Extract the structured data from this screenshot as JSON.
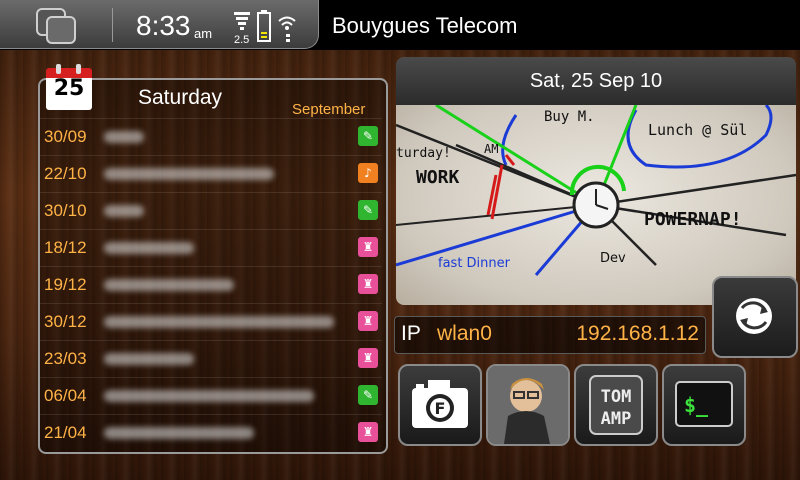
{
  "statusbar": {
    "time": "8:33",
    "ampm": "am",
    "network_type": "2.5",
    "carrier": "Bouygues Telecom"
  },
  "calendar": {
    "icon_day": "25",
    "day_name": "Saturday",
    "month": "September",
    "events": [
      {
        "date": "30/09",
        "title": "",
        "badge_color": "#2fb52f",
        "badge_icon": "tag-icon"
      },
      {
        "date": "22/10",
        "title": "",
        "badge_color": "#f08020",
        "badge_icon": "bell-icon"
      },
      {
        "date": "30/10",
        "title": "",
        "badge_color": "#2fb52f",
        "badge_icon": "tag-icon"
      },
      {
        "date": "18/12",
        "title": "",
        "badge_color": "#e8509a",
        "badge_icon": "cake-icon"
      },
      {
        "date": "19/12",
        "title": "",
        "badge_color": "#e8509a",
        "badge_icon": "cake-icon"
      },
      {
        "date": "30/12",
        "title": "",
        "badge_color": "#e8509a",
        "badge_icon": "cake-icon"
      },
      {
        "date": "23/03",
        "title": "",
        "badge_color": "#e8509a",
        "badge_icon": "cake-icon"
      },
      {
        "date": "06/04",
        "title": "",
        "badge_color": "#2fb52f",
        "badge_icon": "tag-icon"
      },
      {
        "date": "21/04",
        "title": "",
        "badge_color": "#e8509a",
        "badge_icon": "cake-icon"
      }
    ]
  },
  "widget": {
    "date_header": "Sat, 25 Sep 10",
    "whiteboard": {
      "text_buy": "Buy M.",
      "text_am": "AM",
      "text_lunch": "Lunch @ Sül",
      "text_saturday": "turday!",
      "text_work": "WORK",
      "text_powernap": "POWERNAP!",
      "text_fast_dinner": "fast Dinner",
      "text_dev": "Dev"
    }
  },
  "ip": {
    "label": "IP",
    "interface": "wlan0",
    "address": "192.168.1.12"
  },
  "apps": [
    {
      "name": "camera-app",
      "icon": "camera-icon"
    },
    {
      "name": "avatar-app",
      "icon": "avatar-icon"
    },
    {
      "name": "tomamp-app",
      "icon": "tomamp-icon",
      "label_line1": "TOM",
      "label_line2": "AMP"
    },
    {
      "name": "terminal-app",
      "icon": "terminal-icon",
      "prompt": "$_"
    }
  ],
  "colors": {
    "accent_orange": "#ffb347",
    "green_badge": "#2fb52f",
    "orange_badge": "#f08020",
    "pink_badge": "#e8509a"
  }
}
